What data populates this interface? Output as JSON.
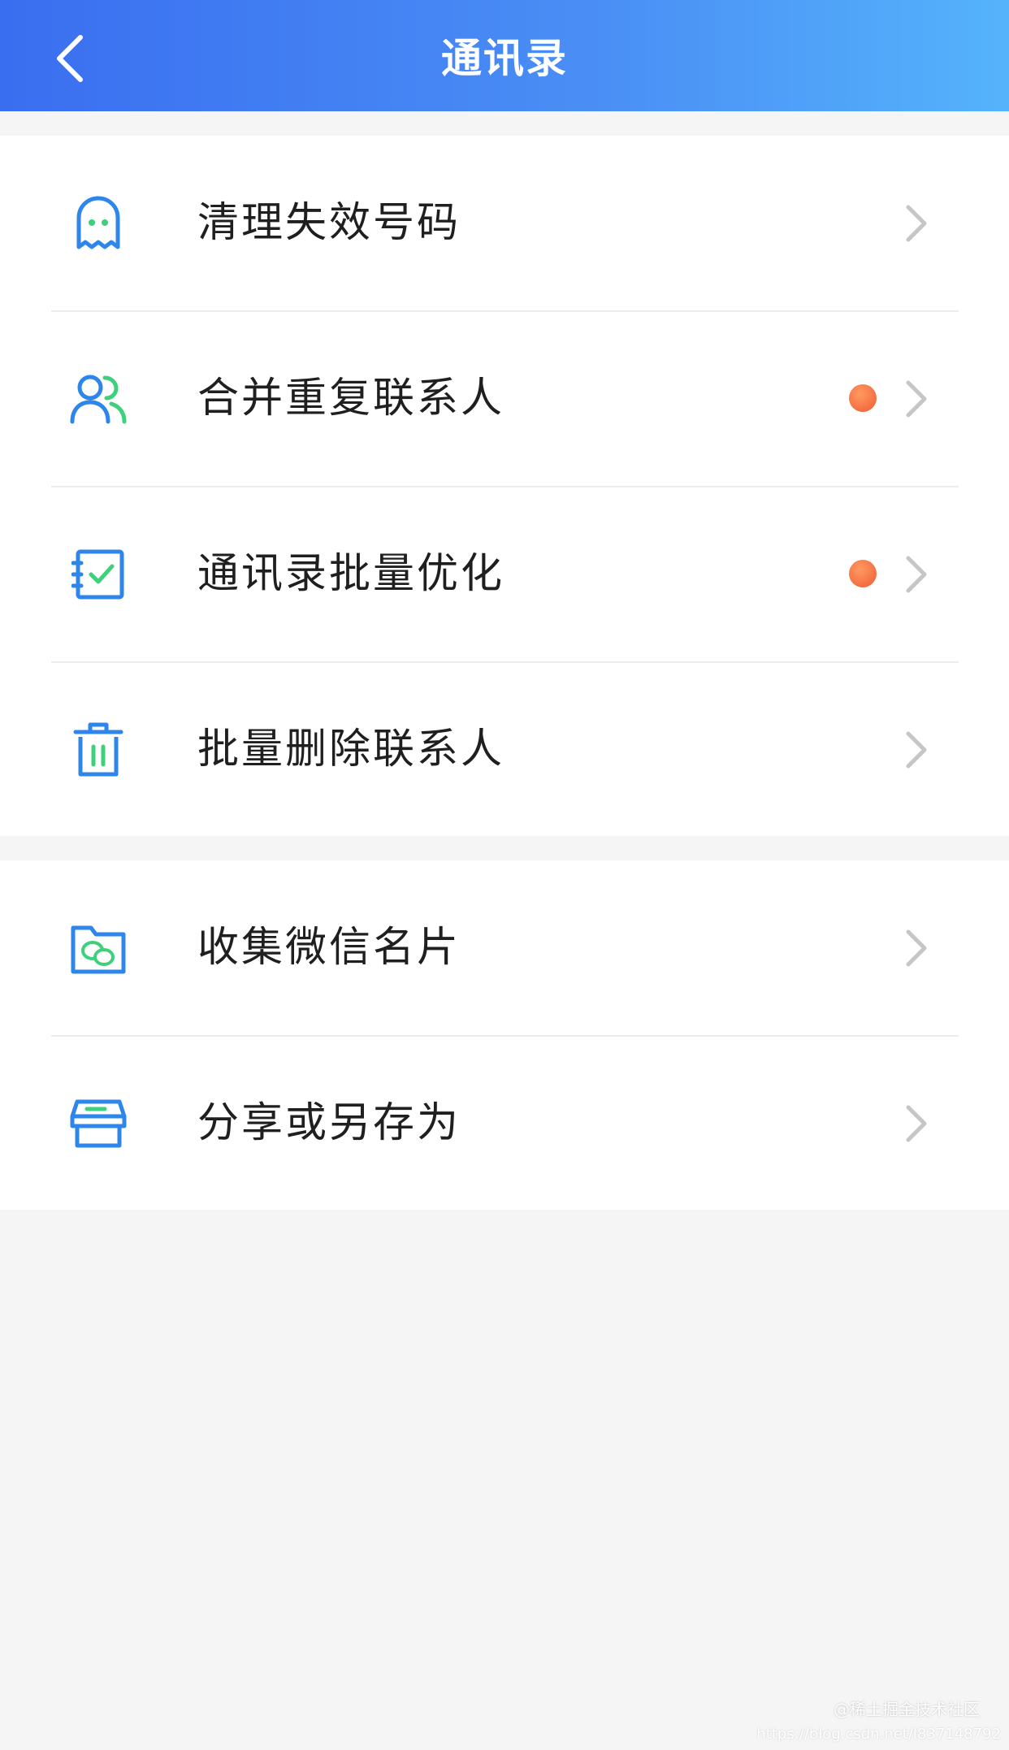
{
  "header": {
    "title": "通讯录",
    "back_icon": "chevron-left-icon"
  },
  "groups": [
    {
      "items": [
        {
          "label": "清理失效号码",
          "icon": "ghost-icon",
          "badge": false
        },
        {
          "label": "合并重复联系人",
          "icon": "contacts-merge-icon",
          "badge": true
        },
        {
          "label": "通讯录批量优化",
          "icon": "checklist-icon",
          "badge": true
        },
        {
          "label": "批量删除联系人",
          "icon": "trash-icon",
          "badge": false
        }
      ]
    },
    {
      "items": [
        {
          "label": "收集微信名片",
          "icon": "wechat-folder-icon",
          "badge": false
        },
        {
          "label": "分享或另存为",
          "icon": "archive-box-icon",
          "badge": false
        }
      ]
    }
  ],
  "watermark": {
    "text": "@稀土掘金技术社区",
    "url": "https://blog.csdn.net/l837148792"
  },
  "colors": {
    "header_start": "#3a6ef0",
    "header_end": "#55b3fb",
    "icon_blue": "#2f86ea",
    "icon_green": "#3ed07a",
    "badge": "#f2683e",
    "chevron": "#c6c6c6",
    "background": "#f5f5f5"
  }
}
